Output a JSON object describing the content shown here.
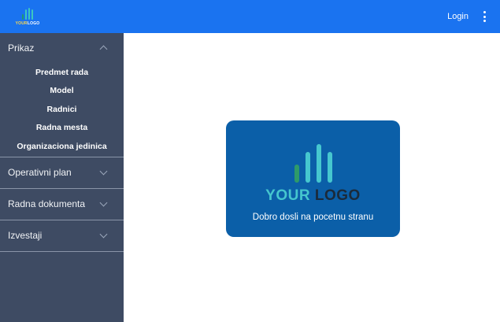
{
  "header": {
    "logo": {
      "word1": "YOUR",
      "word2": "LOGO"
    },
    "login_label": "Login",
    "menu_icon": "kebab-menu-icon"
  },
  "sidebar": {
    "sections": [
      {
        "label": "Prikaz",
        "expanded": true,
        "items": [
          "Predmet rada",
          "Model",
          "Radnici",
          "Radna mesta",
          "Organizaciona jedinica"
        ]
      },
      {
        "label": "Operativni plan",
        "expanded": false
      },
      {
        "label": "Radna dokumenta",
        "expanded": false
      },
      {
        "label": "Izvestaji",
        "expanded": false
      }
    ]
  },
  "main": {
    "card": {
      "logo": {
        "word1": "YOUR",
        "word2": "LOGO"
      },
      "welcome_text": "Dobro dosli na pocetnu stranu"
    }
  },
  "colors": {
    "topbar": "#1a73f0",
    "sidebar": "#3e4b63",
    "card": "#0b5fa8",
    "logo_teal": "#46c7cf",
    "logo_green": "#2e9a6a"
  }
}
